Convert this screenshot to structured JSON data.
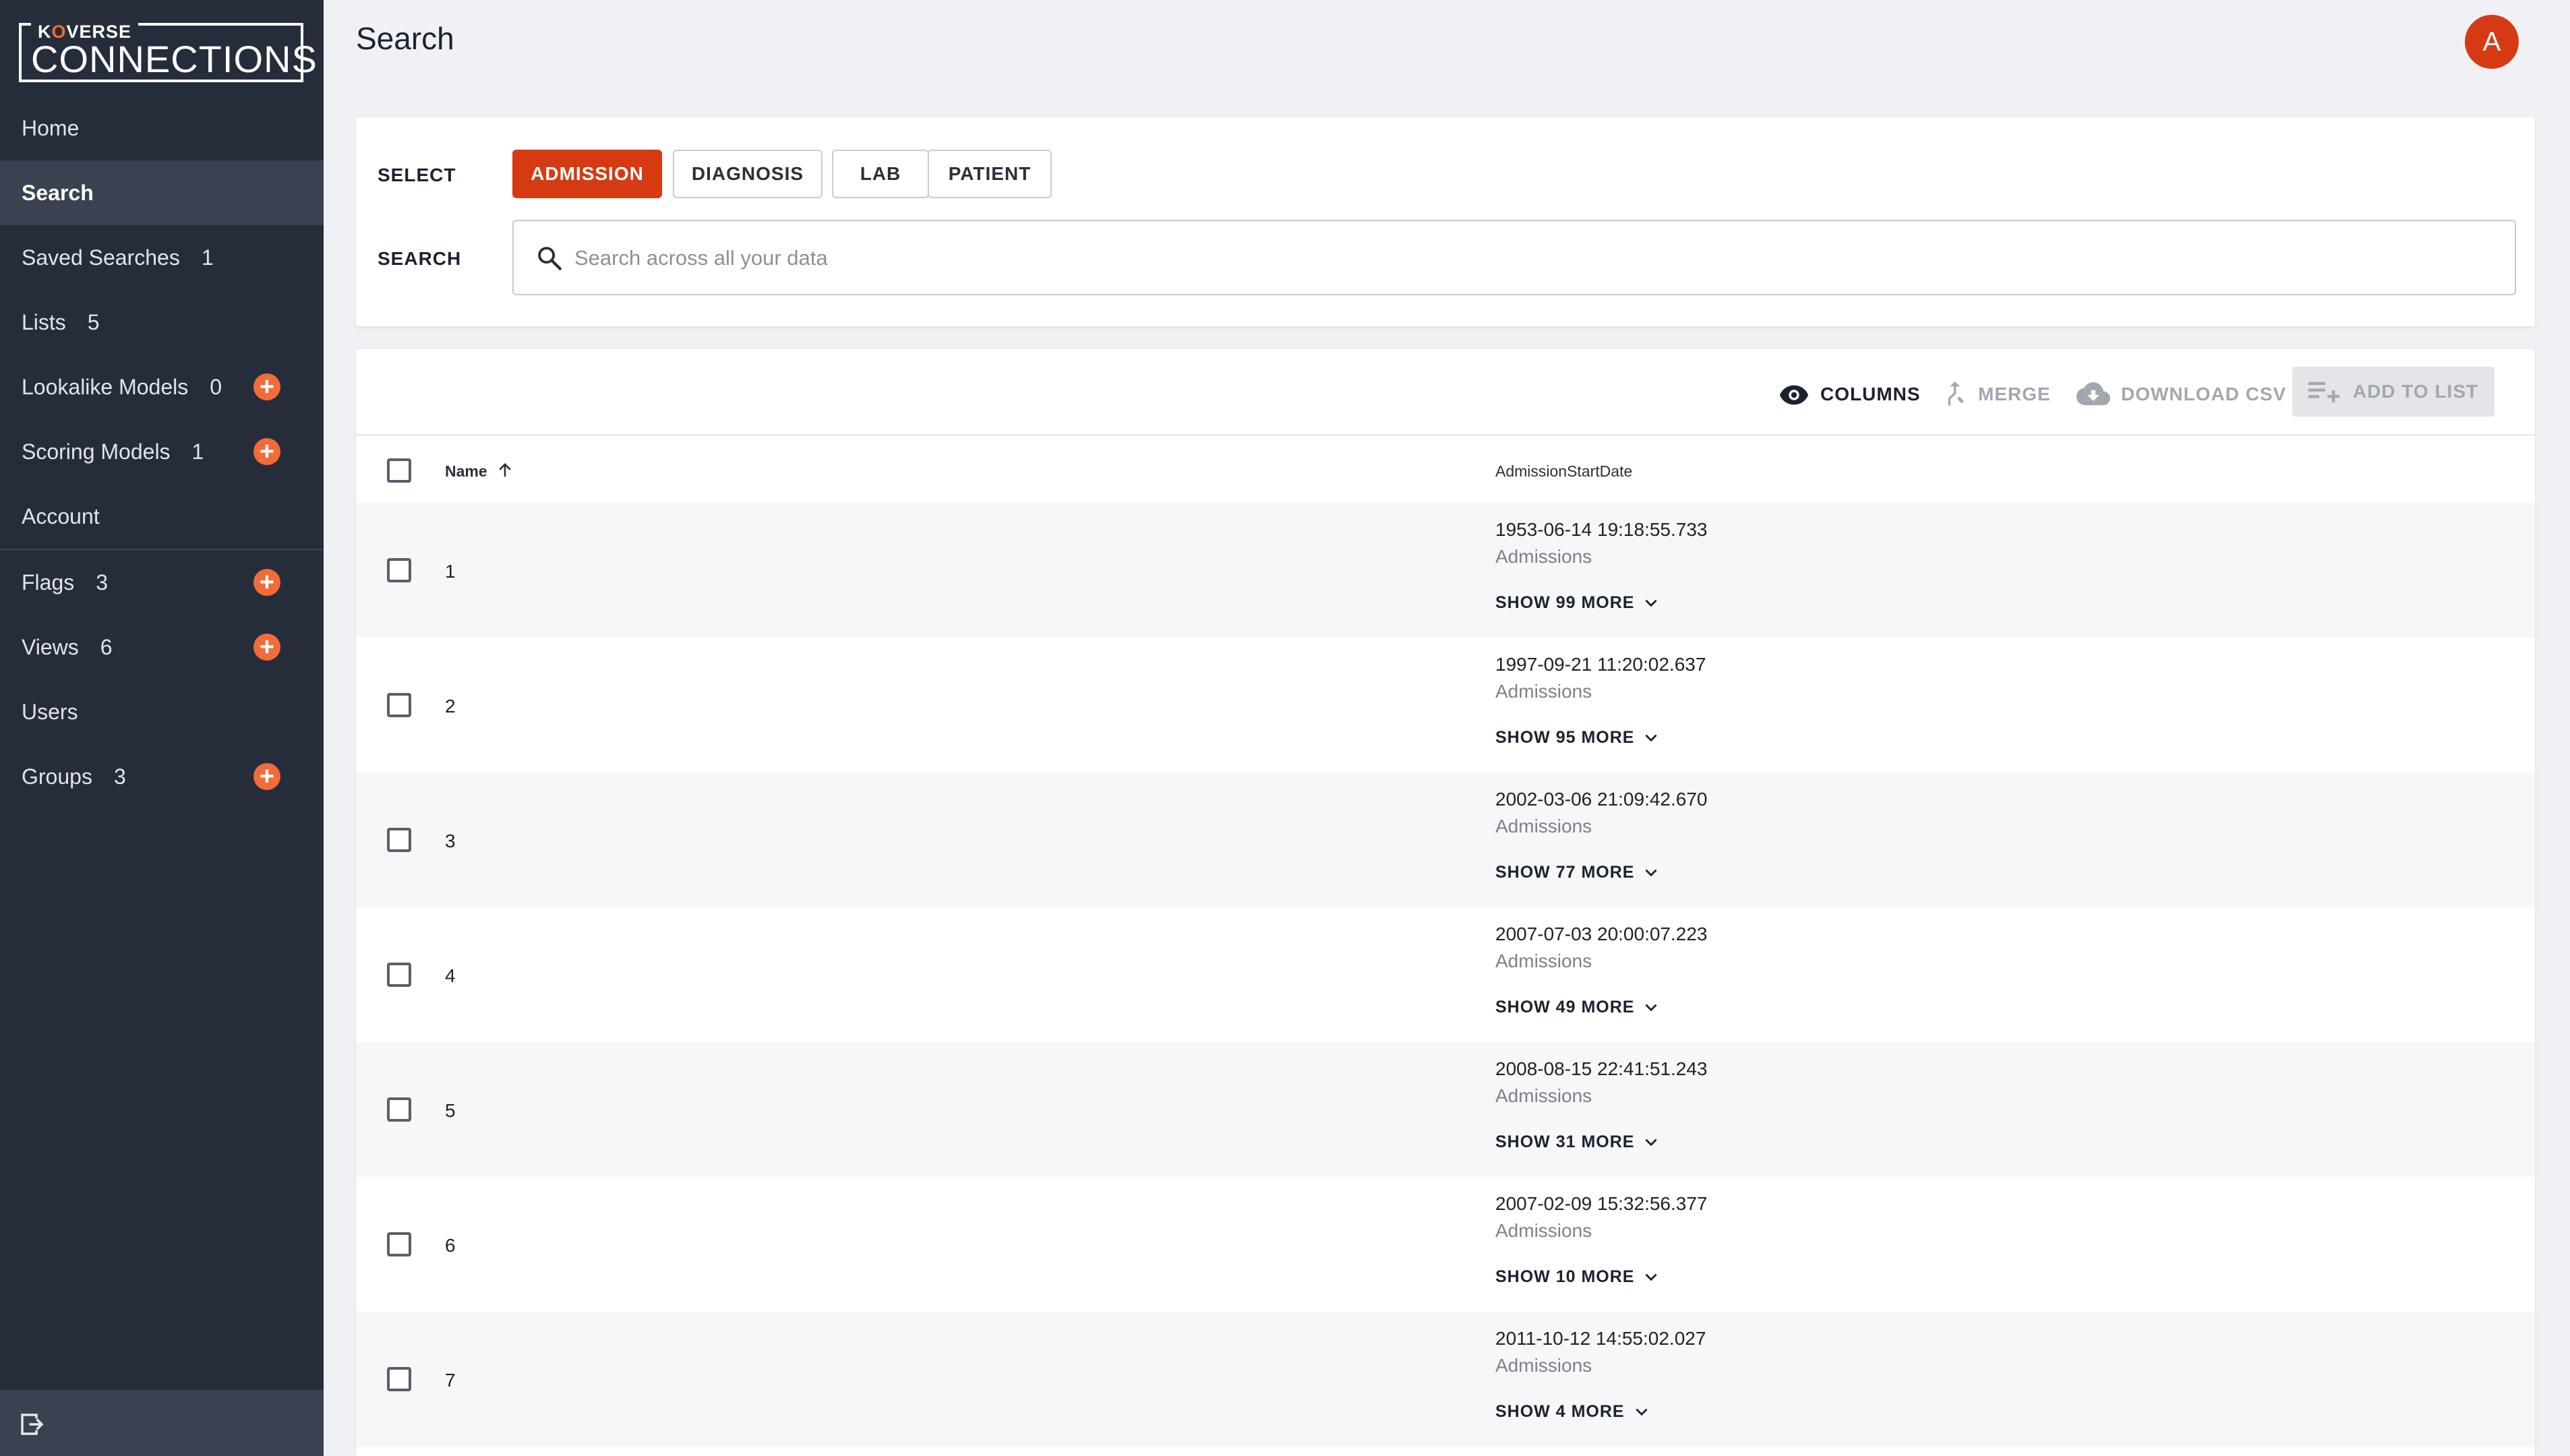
{
  "app": {
    "logo_brand_prefix": "K",
    "logo_brand_o": "O",
    "logo_brand_suffix": "VERSE",
    "logo_product": "CONNECTIONS"
  },
  "sidebar": {
    "items": [
      {
        "label": "Home",
        "count": "",
        "add": false,
        "active": false
      },
      {
        "label": "Search",
        "count": "",
        "add": false,
        "active": true
      },
      {
        "label": "Saved Searches",
        "count": "1",
        "add": false,
        "active": false
      },
      {
        "label": "Lists",
        "count": "5",
        "add": false,
        "active": false
      },
      {
        "label": "Lookalike Models",
        "count": "0",
        "add": true,
        "active": false
      },
      {
        "label": "Scoring Models",
        "count": "1",
        "add": true,
        "active": false
      },
      {
        "label": "Account",
        "count": "",
        "add": false,
        "active": false
      },
      {
        "label": "Flags",
        "count": "3",
        "add": true,
        "active": false
      },
      {
        "label": "Views",
        "count": "6",
        "add": true,
        "active": false
      },
      {
        "label": "Users",
        "count": "",
        "add": false,
        "active": false
      },
      {
        "label": "Groups",
        "count": "3",
        "add": true,
        "active": false
      }
    ],
    "footer_icon": "logout-icon"
  },
  "header": {
    "title": "Search",
    "avatar_initial": "A",
    "avatar_color": "#d63a12"
  },
  "search_panel": {
    "select_label": "SELECT",
    "search_label": "SEARCH",
    "chips": [
      {
        "label": "ADMISSION",
        "selected": true
      },
      {
        "label": "DIAGNOSIS",
        "selected": false
      },
      {
        "label": "LAB",
        "selected": false
      },
      {
        "label": "PATIENT",
        "selected": false
      }
    ],
    "search_placeholder": "Search across all your data",
    "search_value": ""
  },
  "toolbar": {
    "columns_label": "COLUMNS",
    "merge_label": "MERGE",
    "download_label": "DOWNLOAD CSV",
    "add_to_list_label": "ADD TO LIST"
  },
  "table": {
    "columns": [
      "Name",
      "AdmissionStartDate"
    ],
    "sort": {
      "column": "Name",
      "direction": "ascending"
    },
    "rows": [
      {
        "name": "1",
        "date": "1953-06-14 19:18:55.733",
        "source": "Admissions",
        "more": "SHOW 99 MORE"
      },
      {
        "name": "2",
        "date": "1997-09-21 11:20:02.637",
        "source": "Admissions",
        "more": "SHOW 95 MORE"
      },
      {
        "name": "3",
        "date": "2002-03-06 21:09:42.670",
        "source": "Admissions",
        "more": "SHOW 77 MORE"
      },
      {
        "name": "4",
        "date": "2007-07-03 20:00:07.223",
        "source": "Admissions",
        "more": "SHOW 49 MORE"
      },
      {
        "name": "5",
        "date": "2008-08-15 22:41:51.243",
        "source": "Admissions",
        "more": "SHOW 31 MORE"
      },
      {
        "name": "6",
        "date": "2007-02-09 15:32:56.377",
        "source": "Admissions",
        "more": "SHOW 10 MORE"
      },
      {
        "name": "7",
        "date": "2011-10-12 14:55:02.027",
        "source": "Admissions",
        "more": "SHOW 4 MORE"
      }
    ]
  },
  "colors": {
    "accent": "#d63a12",
    "add_button": "#f26b3a",
    "sidebar_bg": "#262d3a"
  }
}
